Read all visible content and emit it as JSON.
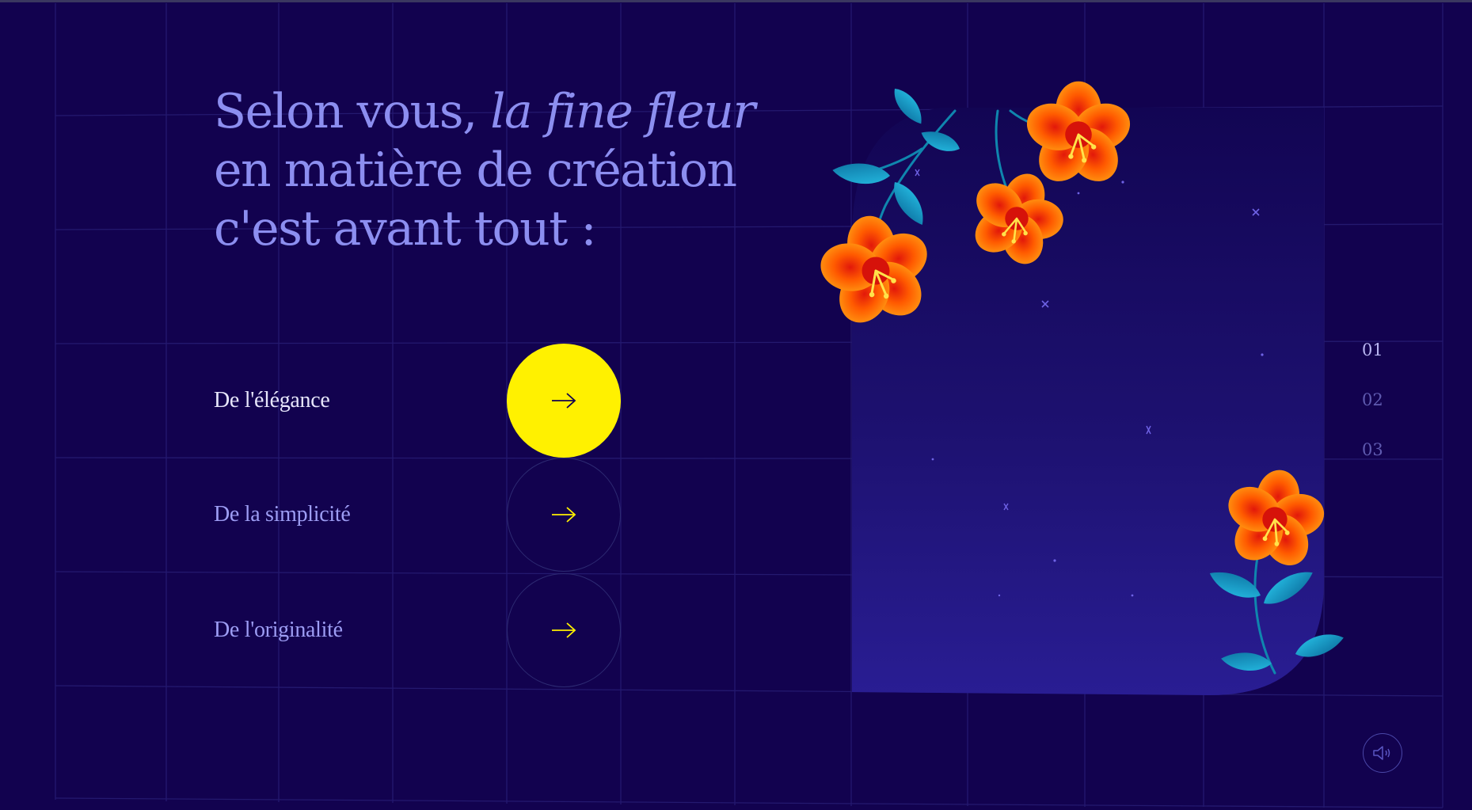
{
  "question": {
    "line1_plain": "Selon vous, ",
    "line1_italic": "la fine fleur",
    "line2": "en matière de création",
    "line3": "c'est avant tout :"
  },
  "answers": [
    {
      "label": "De l'élégance",
      "active": true
    },
    {
      "label": "De la simplicité",
      "active": false
    },
    {
      "label": "De l'originalité",
      "active": false
    }
  ],
  "steps": [
    {
      "label": "01",
      "current": true
    },
    {
      "label": "02",
      "current": false
    },
    {
      "label": "03",
      "current": false
    }
  ],
  "icons": {
    "answer_arrow": "arrow-right-icon",
    "sound": "speaker-icon"
  },
  "colors": {
    "background": "#12024f",
    "accent_yellow": "#fff100",
    "title_text": "#8c8ef0",
    "flower_orange": "#ff7a00",
    "leaf_teal": "#1fa4c9"
  }
}
